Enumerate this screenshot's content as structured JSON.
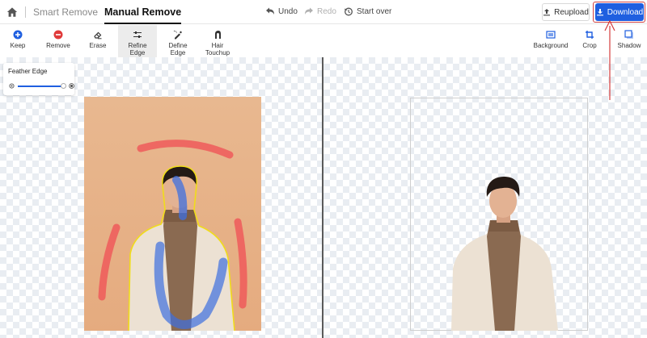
{
  "topbar": {
    "home_icon": "home-icon",
    "tabs": [
      {
        "label": "Smart Remove",
        "active": false
      },
      {
        "label": "Manual Remove",
        "active": true
      }
    ],
    "history": {
      "undo": "Undo",
      "redo": "Redo",
      "start_over": "Start over"
    },
    "reupload_label": "Reupload",
    "download_label": "Download",
    "accent_color": "#1f5fe0"
  },
  "tools": {
    "keep": "Keep",
    "remove": "Remove",
    "erase": "Erase",
    "refine_edge": {
      "line1": "Refine",
      "line2": "Edge",
      "active": true
    },
    "define_edge": {
      "line1": "Define",
      "line2": "Edge"
    },
    "hair_touchup": {
      "line1": "Hair",
      "line2": "Touchup"
    },
    "background": "Background",
    "crop": "Crop",
    "shadow": "Shadow"
  },
  "feather_edge": {
    "title": "Feather Edge",
    "value": 0.95
  },
  "brush_colors": {
    "keep": "#3d6fe0",
    "remove": "#ee5a5a",
    "outline": "#f0dc1a"
  }
}
